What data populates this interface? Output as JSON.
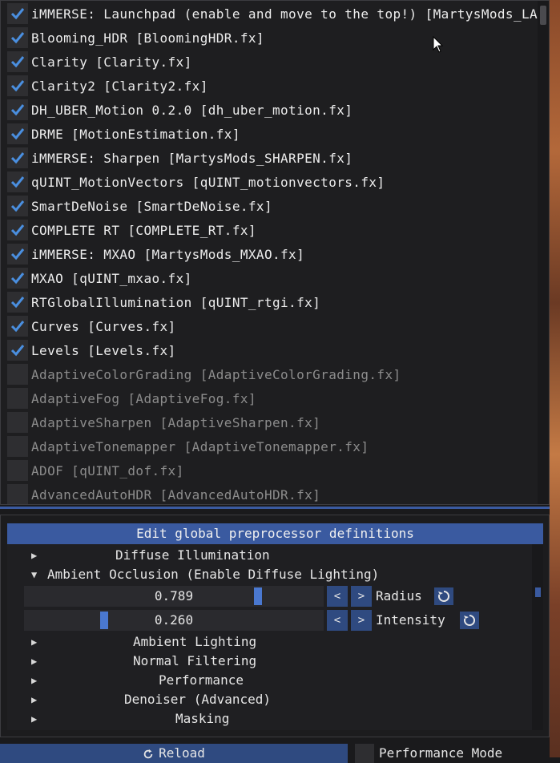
{
  "effects": [
    {
      "label": "iMMERSE: Launchpad (enable and move to the top!) [MartysMods_LAUNCHPAD.fx]",
      "enabled": true
    },
    {
      "label": "Blooming_HDR [BloomingHDR.fx]",
      "enabled": true
    },
    {
      "label": "Clarity [Clarity.fx]",
      "enabled": true
    },
    {
      "label": "Clarity2 [Clarity2.fx]",
      "enabled": true
    },
    {
      "label": "DH_UBER_Motion 0.2.0 [dh_uber_motion.fx]",
      "enabled": true
    },
    {
      "label": "DRME [MotionEstimation.fx]",
      "enabled": true
    },
    {
      "label": "iMMERSE: Sharpen [MartysMods_SHARPEN.fx]",
      "enabled": true
    },
    {
      "label": "qUINT_MotionVectors [qUINT_motionvectors.fx]",
      "enabled": true
    },
    {
      "label": "SmartDeNoise [SmartDeNoise.fx]",
      "enabled": true
    },
    {
      "label": "COMPLETE RT [COMPLETE_RT.fx]",
      "enabled": true
    },
    {
      "label": "iMMERSE: MXAO [MartysMods_MXAO.fx]",
      "enabled": true
    },
    {
      "label": "MXAO [qUINT_mxao.fx]",
      "enabled": true
    },
    {
      "label": "RTGlobalIllumination [qUINT_rtgi.fx]",
      "enabled": true
    },
    {
      "label": "Curves [Curves.fx]",
      "enabled": true
    },
    {
      "label": "Levels [Levels.fx]",
      "enabled": true
    },
    {
      "label": "AdaptiveColorGrading [AdaptiveColorGrading.fx]",
      "enabled": false
    },
    {
      "label": "AdaptiveFog [AdaptiveFog.fx]",
      "enabled": false
    },
    {
      "label": "AdaptiveSharpen [AdaptiveSharpen.fx]",
      "enabled": false
    },
    {
      "label": "AdaptiveTonemapper [AdaptiveTonemapper.fx]",
      "enabled": false
    },
    {
      "label": "ADOF [qUINT_dof.fx]",
      "enabled": false
    },
    {
      "label": "AdvancedAutoHDR [AdvancedAutoHDR.fx]",
      "enabled": false
    }
  ],
  "preprocessor": {
    "header": "Edit global preprocessor definitions"
  },
  "tree": {
    "diffuse_illumination": "Diffuse Illumination",
    "ambient_occlusion": "Ambient Occlusion (Enable Diffuse Lighting)",
    "ambient_lighting": "Ambient Lighting",
    "normal_filtering": "Normal Filtering",
    "performance": "Performance",
    "denoiser": "Denoiser (Advanced)",
    "masking": "Masking",
    "collapsed_arrow": "▶",
    "expanded_arrow": "▼"
  },
  "sliders": {
    "radius": {
      "value": "0.789",
      "label": "Radius",
      "fraction": 0.789
    },
    "intensity": {
      "value": "0.260",
      "label": "Intensity",
      "fraction": 0.26
    },
    "decrement": "<",
    "increment": ">"
  },
  "footer": {
    "reload": "Reload",
    "performance_mode": "Performance Mode"
  },
  "colors": {
    "accent": "#3a5aa0",
    "check": "#4a8fe0",
    "button": "#2f4a80"
  },
  "icons": {
    "check": "check-icon",
    "reset": "reset-icon",
    "reload": "reload-icon",
    "cursor": "mouse-cursor-icon"
  }
}
